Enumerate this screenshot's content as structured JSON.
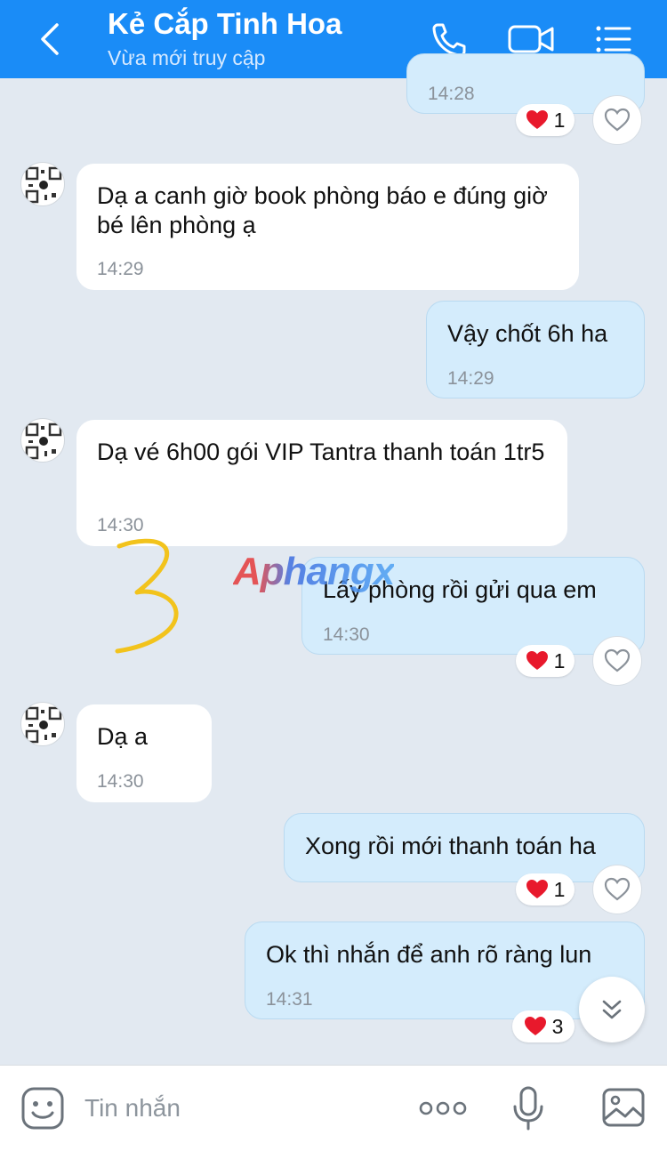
{
  "header": {
    "title": "Kẻ Cắp Tinh Hoa",
    "status": "Vừa mới truy cập",
    "bg_color": "#1a8cf7"
  },
  "messages": [
    {
      "direction": "outgoing",
      "text": "",
      "time": "14:28",
      "reaction_count": "1"
    },
    {
      "direction": "incoming",
      "text": "Dạ a canh giờ book phòng báo e  đúng giờ bé lên phòng ạ",
      "time": "14:29"
    },
    {
      "direction": "outgoing",
      "text": "Vậy chốt 6h ha",
      "time": "14:29"
    },
    {
      "direction": "incoming",
      "text": "Dạ vé 6h00 gói VIP Tantra thanh toán 1tr5",
      "time": "14:30"
    },
    {
      "direction": "outgoing",
      "text": "Lấy phòng rồi gửi qua em",
      "time": "14:30",
      "reaction_count": "1"
    },
    {
      "direction": "incoming",
      "text": "Dạ a",
      "time": "14:30"
    },
    {
      "direction": "outgoing",
      "text": "Xong rồi mới thanh toán ha",
      "time": "",
      "reaction_count": "1"
    },
    {
      "direction": "outgoing",
      "text": "Ok thì nhắn để anh rõ ràng lun",
      "time": "14:31",
      "reaction_count": "3"
    }
  ],
  "watermark": "Aphangx",
  "annotation": "handwritten-number-3",
  "input": {
    "placeholder": "Tin nhắn"
  },
  "colors": {
    "incoming_bubble": "#ffffff",
    "outgoing_bubble": "#d4ecfc",
    "reaction_heart": "#e8192c",
    "background": "#e2e9f1"
  }
}
